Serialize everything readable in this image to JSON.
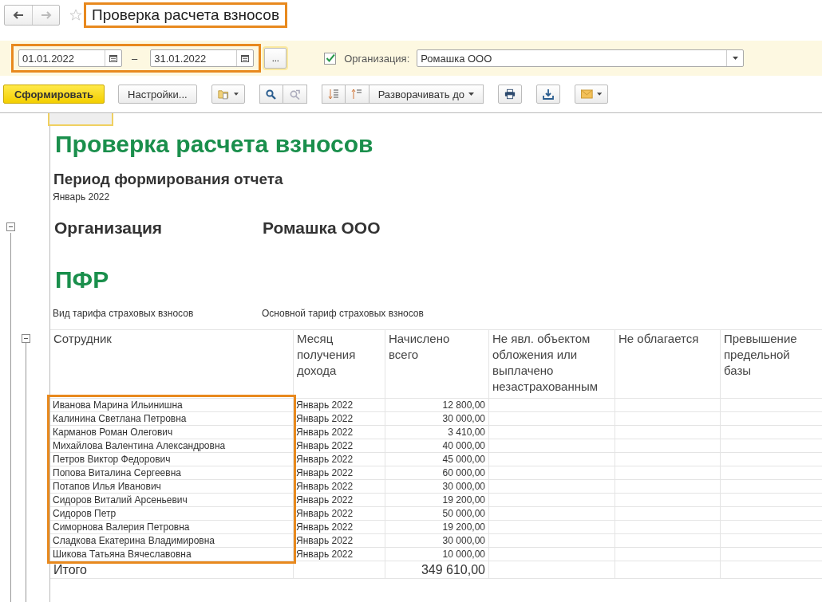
{
  "window": {
    "title": "Проверка расчета взносов"
  },
  "filters": {
    "date_from": "01.01.2022",
    "separator": "–",
    "date_to": "31.01.2022",
    "more_button": "...",
    "organization": {
      "checked": true,
      "label": "Организация:",
      "value": "Ромашка ООО"
    }
  },
  "toolbar": {
    "generate_button": "Сформировать",
    "settings_button": "Настройки...",
    "expand_button": "Разворачивать до"
  },
  "report": {
    "title": "Проверка расчета взносов",
    "period_heading": "Период формирования отчета",
    "period_value": "Январь 2022",
    "organization_label": "Организация",
    "organization_value": "Ромашка ООО",
    "section": "ПФР",
    "tariff_label": "Вид тарифа страховых взносов",
    "tariff_value": "Основной тариф страховых взносов",
    "table": {
      "columns": [
        "Сотрудник",
        "Месяц получения дохода",
        "Начислено всего",
        "Не явл. объектом обложения или выплачено незастрахованным",
        "Не облагается",
        "Превышение предельной базы"
      ],
      "rows": [
        {
          "employee": "Иванова Марина Ильинишна",
          "month": "Январь 2022",
          "accrued": "12 800,00"
        },
        {
          "employee": "Калинина Светлана Петровна",
          "month": "Январь 2022",
          "accrued": "30 000,00"
        },
        {
          "employee": "Карманов Роман Олегович",
          "month": "Январь 2022",
          "accrued": "3 410,00"
        },
        {
          "employee": "Михайлова Валентина Александровна",
          "month": "Январь 2022",
          "accrued": "40 000,00"
        },
        {
          "employee": "Петров Виктор Федорович",
          "month": "Январь 2022",
          "accrued": "45 000,00"
        },
        {
          "employee": "Попова Виталина Сергеевна",
          "month": "Январь 2022",
          "accrued": "60 000,00"
        },
        {
          "employee": "Потапов Илья Иванович",
          "month": "Январь 2022",
          "accrued": "30 000,00"
        },
        {
          "employee": "Сидоров Виталий Арсеньевич",
          "month": "Январь 2022",
          "accrued": "19 200,00"
        },
        {
          "employee": "Сидоров Петр",
          "month": "Январь 2022",
          "accrued": "50 000,00"
        },
        {
          "employee": "Симорнова Валерия Петровна",
          "month": "Январь 2022",
          "accrued": "19 200,00"
        },
        {
          "employee": "Сладкова Екатерина Владимировна",
          "month": "Январь 2022",
          "accrued": "30 000,00"
        },
        {
          "employee": "Шикова Татьяна Вячеславовна",
          "month": "Январь 2022",
          "accrued": "10 000,00"
        }
      ],
      "total": {
        "label": "Итого",
        "accrued": "349 610,00"
      }
    }
  }
}
